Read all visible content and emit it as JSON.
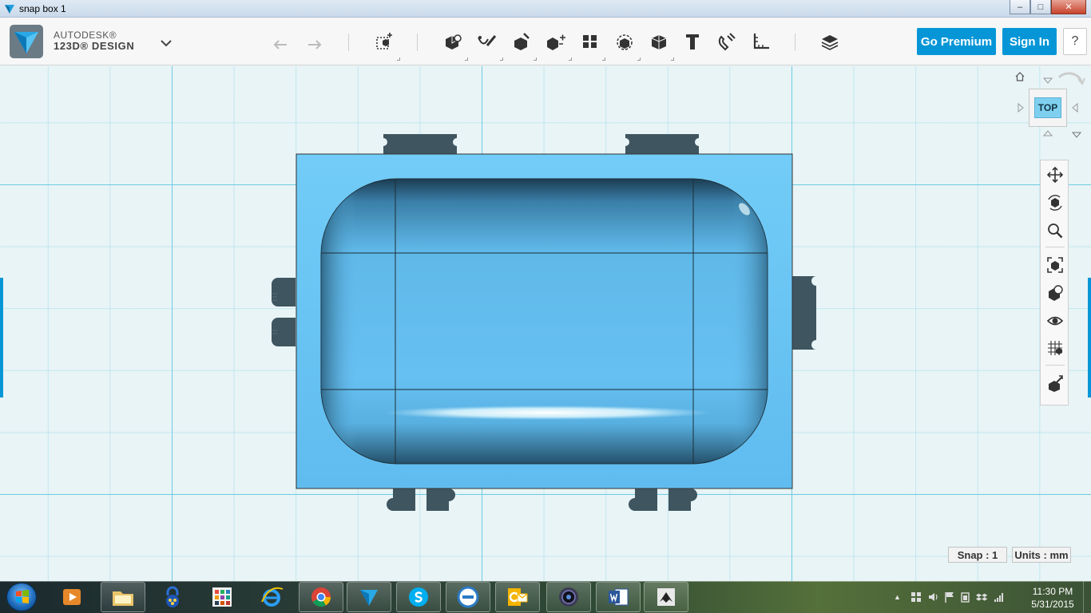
{
  "window": {
    "title": "snap box 1",
    "minimize_glyph": "–",
    "maximize_glyph": "□",
    "close_glyph": "✕"
  },
  "app": {
    "brand_line1": "AUTODESK®",
    "brand_line2": "123D® DESIGN"
  },
  "toolbar": {
    "go_premium": "Go Premium",
    "sign_in": "Sign In",
    "help": "?",
    "tools": [
      "undo-icon",
      "redo-icon",
      "primitives-icon",
      "sketch-icon",
      "construct-icon",
      "modify-icon",
      "pattern-icon",
      "grouping-icon",
      "combine-icon",
      "measure-icon",
      "text-icon",
      "snap-icon",
      "ruler-icon",
      "material-icon"
    ]
  },
  "viewcube": {
    "face_label": "TOP"
  },
  "navbar": {
    "items": [
      "pan-icon",
      "orbit-icon",
      "zoom-icon",
      "fit-icon",
      "view-mode-icon",
      "visibility-icon",
      "grid-material-icon",
      "tweak-icon"
    ]
  },
  "status": {
    "snap": "Snap : 1",
    "units": "Units : mm"
  },
  "taskbar": {
    "apps": [
      "media-player-icon",
      "file-explorer-icon",
      "security-icon",
      "app-grid-icon",
      "internet-explorer-icon",
      "chrome-icon",
      "123d-design-icon",
      "skype-icon",
      "dell-icon",
      "outlook-icon",
      "camera-icon",
      "word-icon",
      "inkscape-icon"
    ],
    "time": "11:30 PM",
    "date": "5/31/2015"
  },
  "colors": {
    "accent": "#0696d7",
    "model_fill": "#66c2f5",
    "model_dark": "#3f5560",
    "grid_major": "#64c8e1"
  }
}
